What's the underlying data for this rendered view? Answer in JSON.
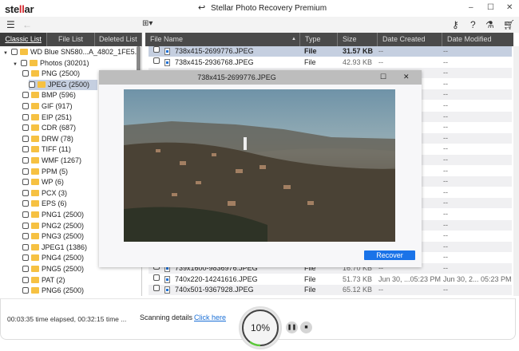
{
  "app": {
    "logo": "stellar",
    "title": "Stellar Photo Recovery Premium"
  },
  "tabs": [
    "Classic List",
    "File List",
    "Deleted List"
  ],
  "columns": [
    "File Name",
    "Type",
    "Size",
    "Date Created",
    "Date Modified"
  ],
  "tree": [
    {
      "label": "WD Blue SN580...A_4802_1FE5.)",
      "level": 0,
      "expanded": true
    },
    {
      "label": "Photos (30201)",
      "level": 1,
      "expanded": true
    },
    {
      "label": "PNG (2500)",
      "level": 2
    },
    {
      "label": "JPEG (2500)",
      "level": 2,
      "selected": true
    },
    {
      "label": "BMP (596)",
      "level": 2
    },
    {
      "label": "GIF (917)",
      "level": 2
    },
    {
      "label": "EIP (251)",
      "level": 2
    },
    {
      "label": "CDR (687)",
      "level": 2
    },
    {
      "label": "DRW (78)",
      "level": 2
    },
    {
      "label": "TIFF (11)",
      "level": 2
    },
    {
      "label": "WMF (1267)",
      "level": 2
    },
    {
      "label": "PPM (5)",
      "level": 2
    },
    {
      "label": "WP (6)",
      "level": 2
    },
    {
      "label": "PCX (3)",
      "level": 2
    },
    {
      "label": "EPS (6)",
      "level": 2
    },
    {
      "label": "PNG1 (2500)",
      "level": 2
    },
    {
      "label": "PNG2 (2500)",
      "level": 2
    },
    {
      "label": "PNG3 (2500)",
      "level": 2
    },
    {
      "label": "JPEG1 (1386)",
      "level": 2
    },
    {
      "label": "PNG4 (2500)",
      "level": 2
    },
    {
      "label": "PNG5 (2500)",
      "level": 2
    },
    {
      "label": "PAT (2)",
      "level": 2
    },
    {
      "label": "PNG6 (2500)",
      "level": 2
    }
  ],
  "files": [
    {
      "name": "738x415-2699776.JPEG",
      "type": "File",
      "size": "31.57 KB",
      "created": "--",
      "modified": "--",
      "selected": true
    },
    {
      "name": "738x415-2936768.JPEG",
      "type": "File",
      "size": "42.93 KB",
      "created": "--",
      "modified": "--"
    },
    {
      "name": "",
      "type": "",
      "size": "",
      "created": "",
      "modified": "--"
    },
    {
      "name": "",
      "type": "",
      "size": "",
      "created": "",
      "modified": "--"
    },
    {
      "name": "",
      "type": "",
      "size": "",
      "created": "",
      "modified": "--"
    },
    {
      "name": "",
      "type": "",
      "size": "",
      "created": "",
      "modified": "--"
    },
    {
      "name": "",
      "type": "",
      "size": "",
      "created": "",
      "modified": "--"
    },
    {
      "name": "",
      "type": "",
      "size": "",
      "created": "",
      "modified": "--"
    },
    {
      "name": "",
      "type": "",
      "size": "",
      "created": "",
      "modified": "--"
    },
    {
      "name": "",
      "type": "",
      "size": "",
      "created": "",
      "modified": "--"
    },
    {
      "name": "",
      "type": "",
      "size": "",
      "created": "",
      "modified": "--"
    },
    {
      "name": "",
      "type": "",
      "size": "",
      "created": "",
      "modified": "--"
    },
    {
      "name": "",
      "type": "",
      "size": "",
      "created": "",
      "modified": "--"
    },
    {
      "name": "",
      "type": "",
      "size": "",
      "created": "",
      "modified": "--"
    },
    {
      "name": "",
      "type": "",
      "size": "",
      "created": "",
      "modified": "--"
    },
    {
      "name": "",
      "type": "",
      "size": "",
      "created": "",
      "modified": "--"
    },
    {
      "name": "",
      "type": "",
      "size": "",
      "created": "",
      "modified": "--"
    },
    {
      "name": "",
      "type": "",
      "size": "",
      "created": "",
      "modified": "--"
    },
    {
      "name": "",
      "type": "",
      "size": "",
      "created": "",
      "modified": "--"
    },
    {
      "name": "",
      "type": "",
      "size": "",
      "created": "",
      "modified": "--"
    },
    {
      "name": "739x1600-9836976.JPEG",
      "type": "File",
      "size": "16.70 KB",
      "created": "--",
      "modified": "--"
    },
    {
      "name": "740x220-14241616.JPEG",
      "type": "File",
      "size": "51.73 KB",
      "created": "Jun 30, ...05:23 PM",
      "modified": "Jun 30, 2... 05:23 PM"
    },
    {
      "name": "740x501-9367928.JPEG",
      "type": "File",
      "size": "65.12 KB",
      "created": "--",
      "modified": "--"
    }
  ],
  "preview": {
    "title": "738x415-2699776.JPEG",
    "recover_label": "Recover"
  },
  "status": {
    "elapsed": "00:03:35 time elapsed, 00:32:15 time ...",
    "scan_label": "Scanning details",
    "link": "Click here",
    "progress_text": "10%",
    "progress": 0.1
  },
  "colors": {
    "accent": "#1a73e8",
    "progress": "#5cc93a",
    "header": "#4a4a4a",
    "selection": "#c5cfe0"
  }
}
